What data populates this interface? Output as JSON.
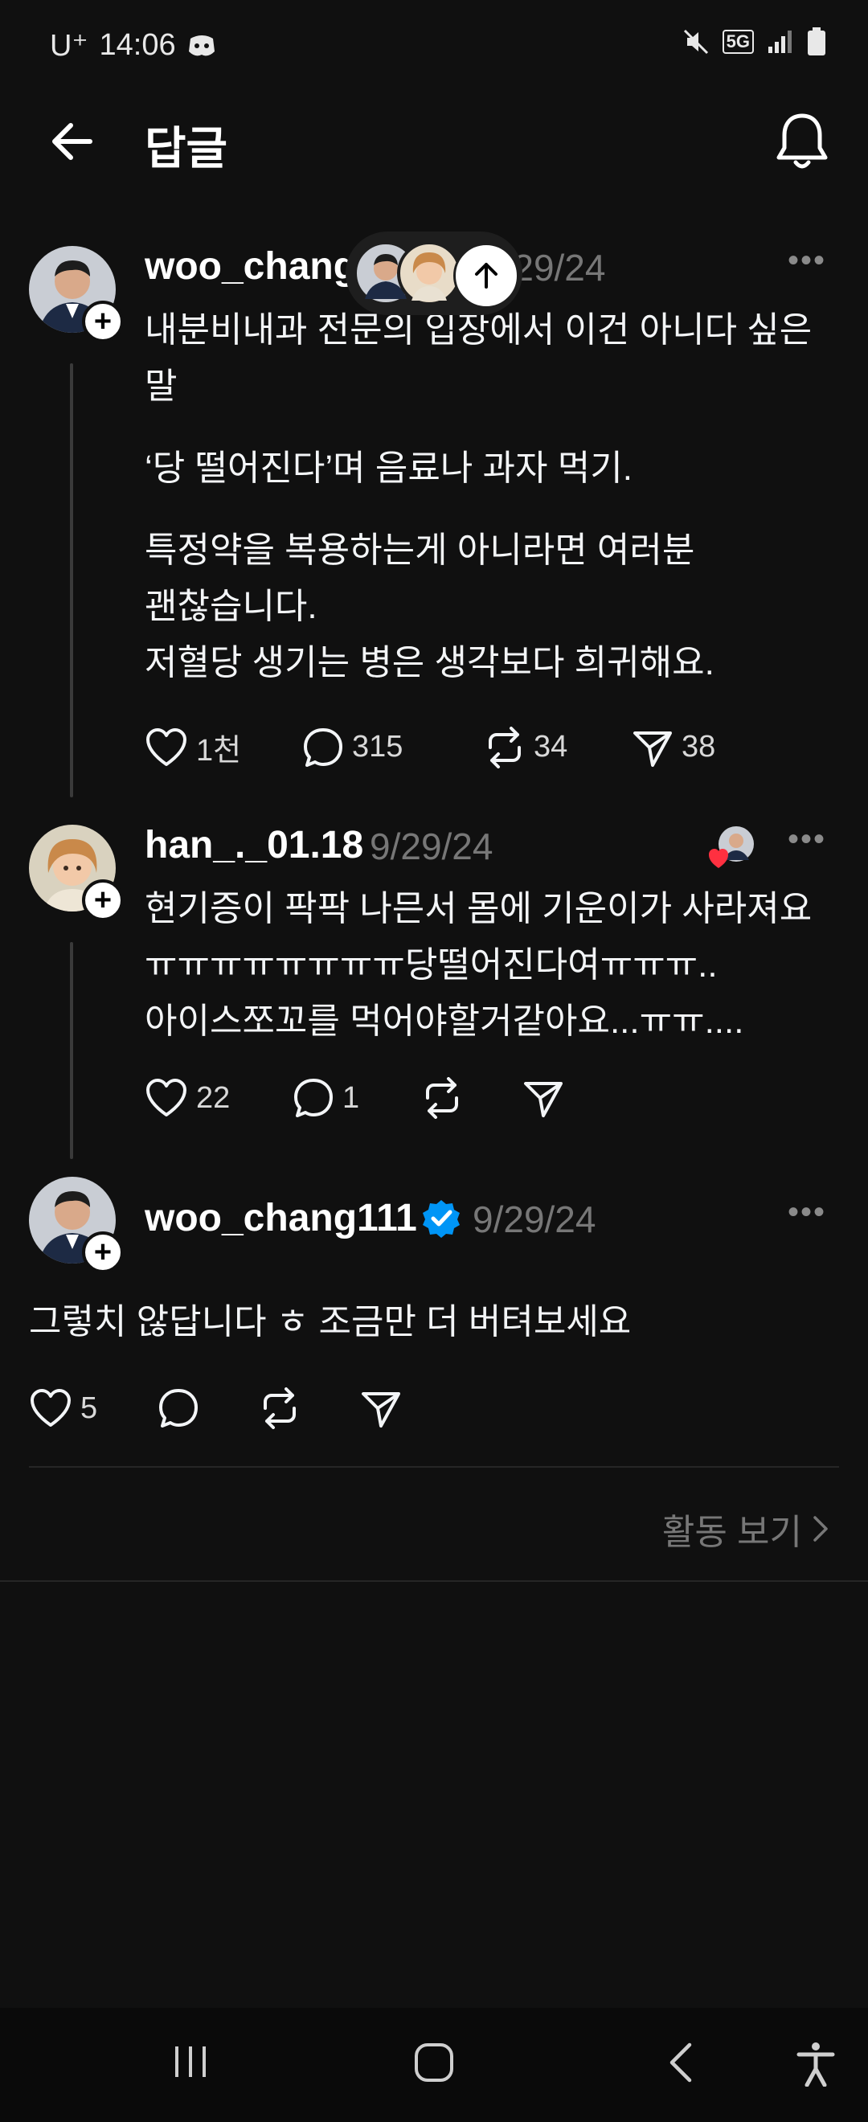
{
  "status_bar": {
    "carrier": "U⁺",
    "time": "14:06",
    "network": "5G"
  },
  "header": {
    "title": "답글"
  },
  "posts": [
    {
      "username": "woo_chang",
      "date": "9/29/24",
      "lines": [
        "내분비내과 전문의 입장에서 이건 아니다 싶은",
        "말",
        "‘당 떨어진다’며 음료나 과자 먹기.",
        "특정약을 복용하는게 아니라면 여러분",
        "괜찮습니다.",
        "저혈당 생기는 병은 생각보다 희귀해요."
      ],
      "likes": "1천",
      "replies": "315",
      "reposts": "34",
      "shares": "38"
    },
    {
      "username": "han_._01.18",
      "date": "9/29/24",
      "lines": [
        "현기증이 팍팍 나믄서 몸에 기운이가 사라져요",
        "ㅠㅠㅠㅠㅠㅠㅠㅠ당떨어진다여ㅠㅠㅠ..",
        "아이스쪼꼬를 먹어야할거같아요...ㅠㅠ...."
      ],
      "likes": "22",
      "replies": "1"
    },
    {
      "username": "woo_chang111",
      "date": "9/29/24",
      "text": "그렇치 않답니다 ㅎ 조금만 더 버텨보세요",
      "likes": "5"
    }
  ],
  "activity_link": "활동 보기",
  "icons": [
    "back-arrow-icon",
    "bell-icon",
    "heart-icon",
    "comment-icon",
    "repost-icon",
    "send-icon",
    "more-icon",
    "verified-icon",
    "scroll-up-icon"
  ],
  "colors": {
    "background": "#101010",
    "verified": "#0095f6",
    "heart": "#ff3040"
  }
}
